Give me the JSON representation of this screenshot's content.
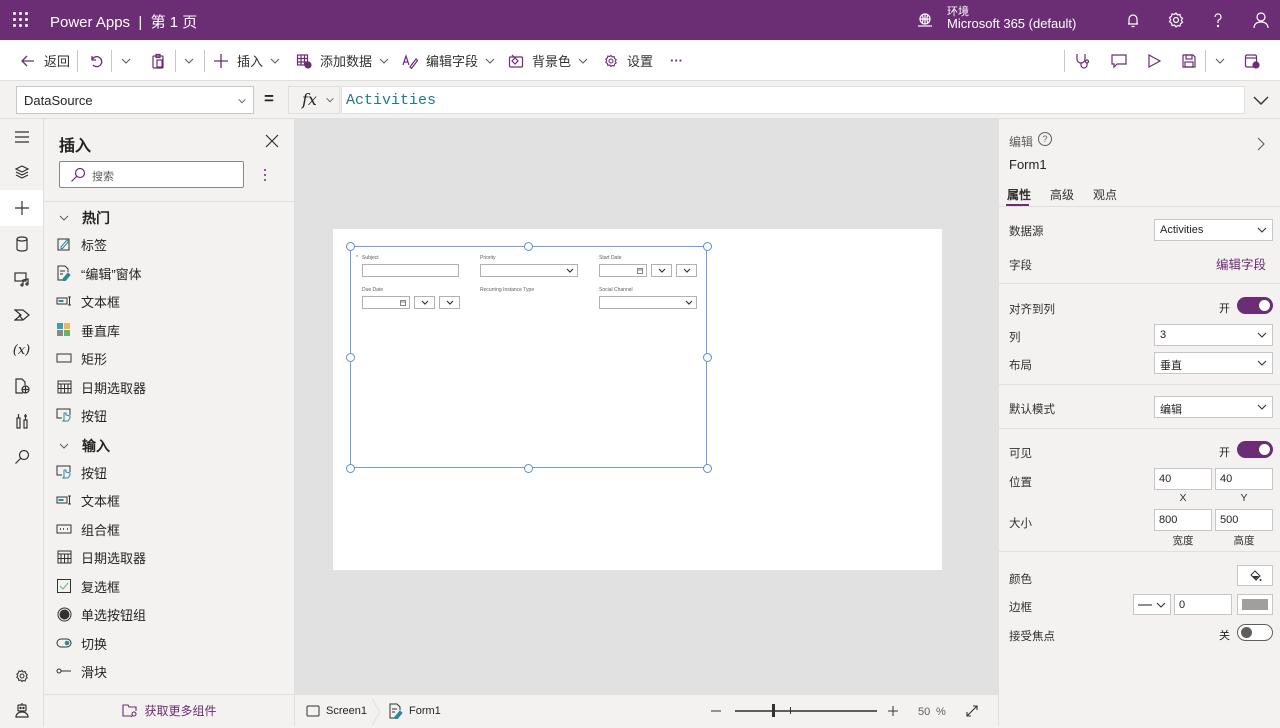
{
  "topbar": {
    "app_title": "Power Apps  |  第 1 页",
    "env_label": "环境",
    "env_value": "Microsoft 365 (default)",
    "brand_color": "#6b2d73"
  },
  "cmdbar": {
    "back": "返回",
    "insert": "插入",
    "add_data": "添加数据",
    "edit_fields": "编辑字段",
    "background": "背景色",
    "settings": "设置",
    "more": "···"
  },
  "formula_bar": {
    "property": "DataSource",
    "equals": "=",
    "fx": "fx",
    "formula": "Activities"
  },
  "insert_panel": {
    "title": "插入",
    "search_placeholder": "搜索",
    "sections": [
      {
        "title": "热门",
        "items": [
          "标签",
          "“编辑”窗体",
          "文本框",
          "垂直库",
          "矩形",
          "日期选取器",
          "按钮"
        ]
      },
      {
        "title": "输入",
        "items": [
          "按钮",
          "文本框",
          "组合框",
          "日期选取器",
          "复选框",
          "单选按钮组",
          "切换",
          "滑块"
        ]
      }
    ],
    "get_more": "获取更多组件"
  },
  "form": {
    "fields": {
      "subject": "Subject",
      "priority": "Priority",
      "start_date": "Start Date",
      "due_date": "Due Date",
      "recurring": "Recurring Instance Type",
      "social": "Social Channel"
    }
  },
  "statusbar": {
    "screen": "Screen1",
    "control": "Form1",
    "zoom_value": "50",
    "zoom_unit": "%",
    "zoom_level_fraction": 0.26
  },
  "properties": {
    "header": "编辑",
    "control_name": "Form1",
    "tabs": [
      "属性",
      "高级",
      "观点"
    ],
    "data_source_label": "数据源",
    "data_source_value": "Activities",
    "fields_label": "字段",
    "fields_link": "编辑字段",
    "snap_label": "对齐到列",
    "snap_state": "开",
    "columns_label": "列",
    "columns_value": "3",
    "layout_label": "布局",
    "layout_value": "垂直",
    "default_mode_label": "默认模式",
    "default_mode_value": "编辑",
    "visible_label": "可见",
    "visible_state": "开",
    "position_label": "位置",
    "x_value": "40",
    "y_value": "40",
    "x_label": "X",
    "y_label": "Y",
    "size_label": "大小",
    "width_value": "800",
    "height_value": "500",
    "width_label": "宽度",
    "height_label": "高度",
    "color_label": "颜色",
    "border_label": "边框",
    "border_value": "0",
    "border_color": "#a19f9d",
    "focus_label": "接受焦点",
    "focus_state": "关"
  }
}
